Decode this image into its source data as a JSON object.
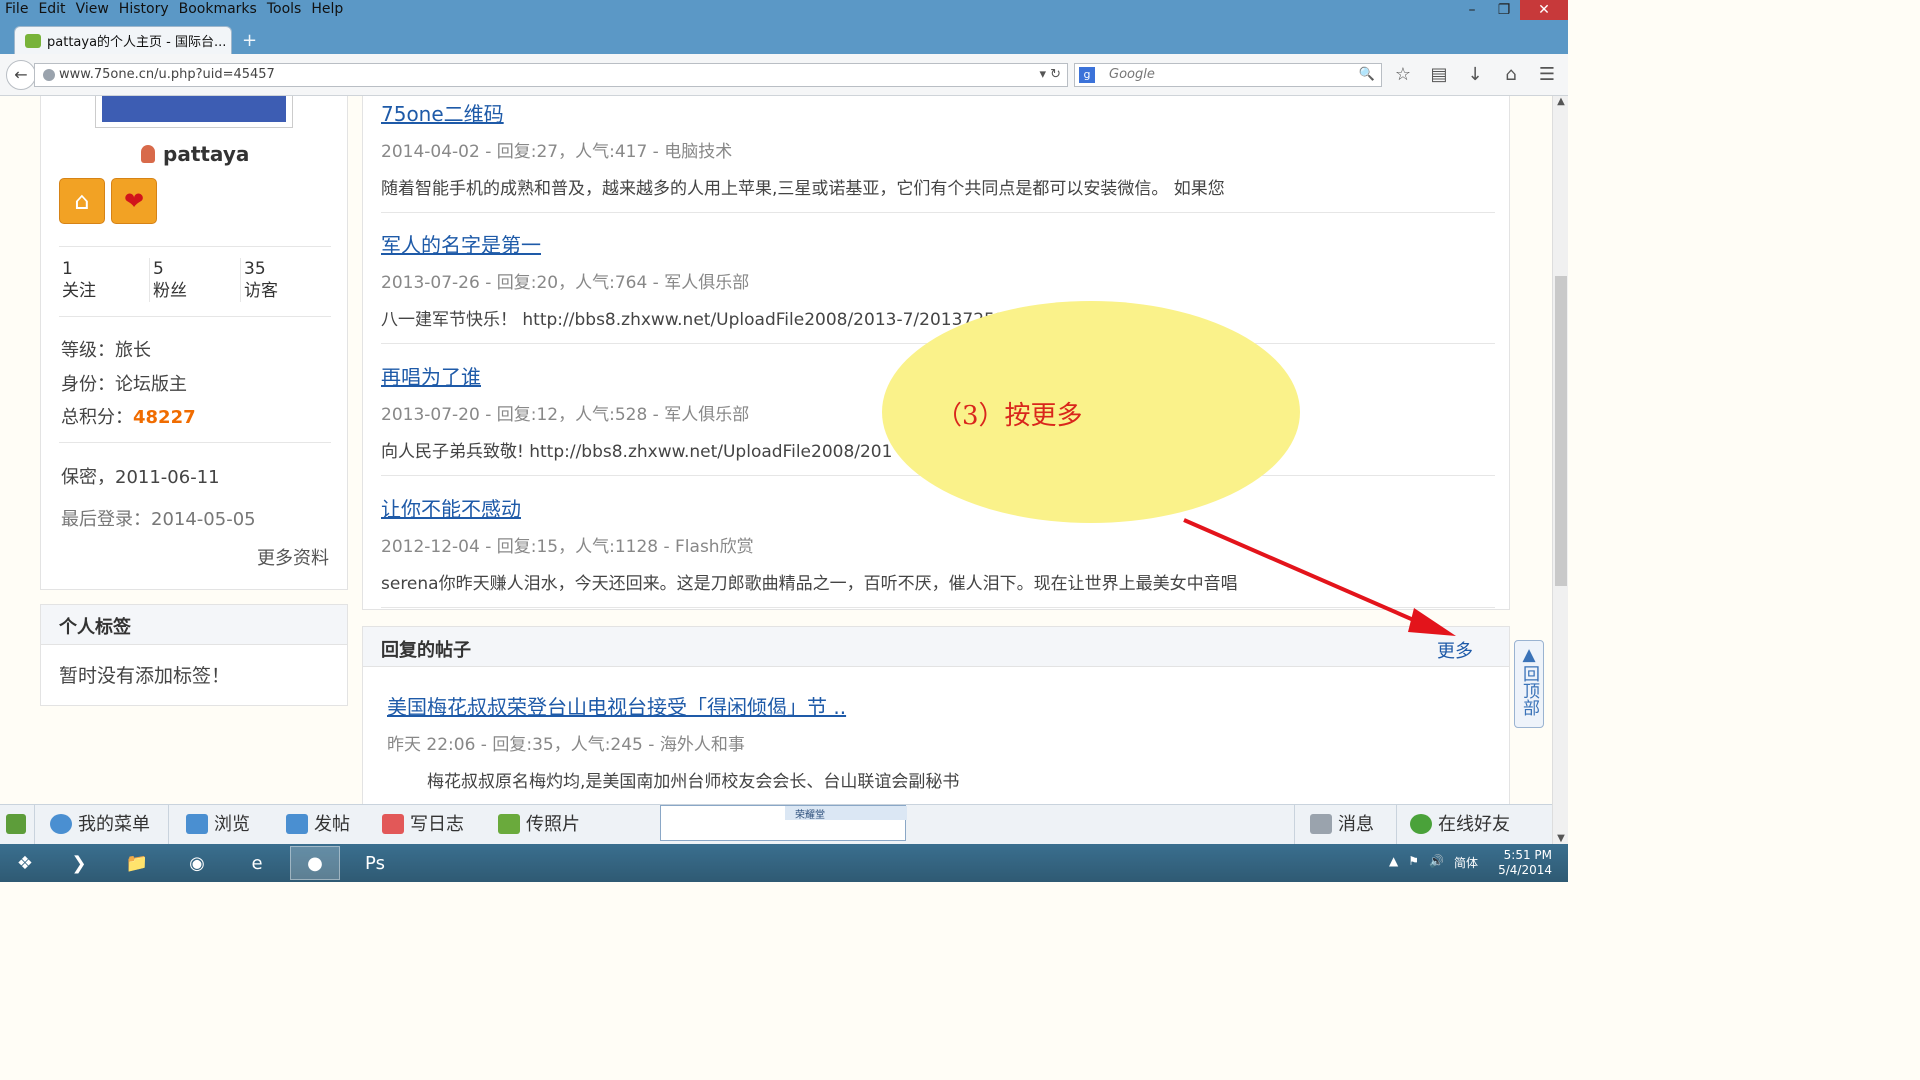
{
  "browser": {
    "menu": [
      "File",
      "Edit",
      "View",
      "History",
      "Bookmarks",
      "Tools",
      "Help"
    ],
    "tab_title": "pattaya的个人主页 - 国际台...",
    "url": "www.75one.cn/u.php?uid=45457",
    "search_placeholder": "Google",
    "new_tab": "+"
  },
  "profile": {
    "username": "pattaya",
    "stats": [
      {
        "value": "1",
        "label": "关注"
      },
      {
        "value": "5",
        "label": "粉丝"
      },
      {
        "value": "35",
        "label": "访客"
      }
    ],
    "level": "等级：旅长",
    "identity": "身份：论坛版主",
    "score_label": "总积分：",
    "score": "48227",
    "join": "保密，2011-06-11",
    "last_login": "最后登录：2014-05-05",
    "more": "更多资料"
  },
  "tags": {
    "title": "个人标签",
    "empty": "暂时没有添加标签！"
  },
  "posts": [
    {
      "title": "75one二维码",
      "meta": "2014-04-02 - 回复:27，人气:417 - 电脑技术",
      "desc": "随着智能手机的成熟和普及，越来越多的人用上苹果,三星或诺基亚，它们有个共同点是都可以安装微信。 如果您"
    },
    {
      "title": "军人的名字是第一",
      "meta": "2013-07-26 - 回复:20，人气:764 - 军人俱乐部",
      "desc": "八一建军节快乐！ http://bbs8.zhxww.net/UploadFile2008/2013-7/20137252333"
    },
    {
      "title": "再唱为了谁",
      "meta": "2013-07-20 - 回复:12，人气:528 - 军人俱乐部",
      "desc": "向人民子弟兵致敬! http://bbs8.zhxww.net/UploadFile2008/201"
    },
    {
      "title": "让你不能不感动",
      "meta": "2012-12-04 - 回复:15，人气:1128 - Flash欣赏",
      "desc": "serena你昨天赚人泪水，今天还回来。这是刀郎歌曲精品之一，百听不厌，催人泪下。现在让世界上最美女中音唱"
    }
  ],
  "replies": {
    "title": "回复的帖子",
    "more": "更多",
    "post": {
      "title": "美国梅花叔叔荣登台山电视台接受「得闲倾偈」节 ..",
      "meta": "昨天 22:06 - 回复:35，人气:245 - 海外人和事",
      "desc": "梅花叔叔原名梅灼均,是美国南加州台师校友会会长、台山联谊会副秘书"
    }
  },
  "back_to_top": "回顶部",
  "annotation": "（3）按更多",
  "bottom_bar": {
    "items": [
      "我的菜单",
      "浏览",
      "发帖",
      "写日志",
      "传照片"
    ],
    "right": [
      "消息",
      "在线好友"
    ],
    "ime_label": "荣耀堂"
  },
  "taskbar": {
    "lang": "简体",
    "time": "5:51 PM",
    "date": "5/4/2014"
  },
  "colors": {
    "accent": "#1e5aa8",
    "score": "#f06c00",
    "bubble": "#faf28a",
    "arrow": "#e3141b"
  }
}
